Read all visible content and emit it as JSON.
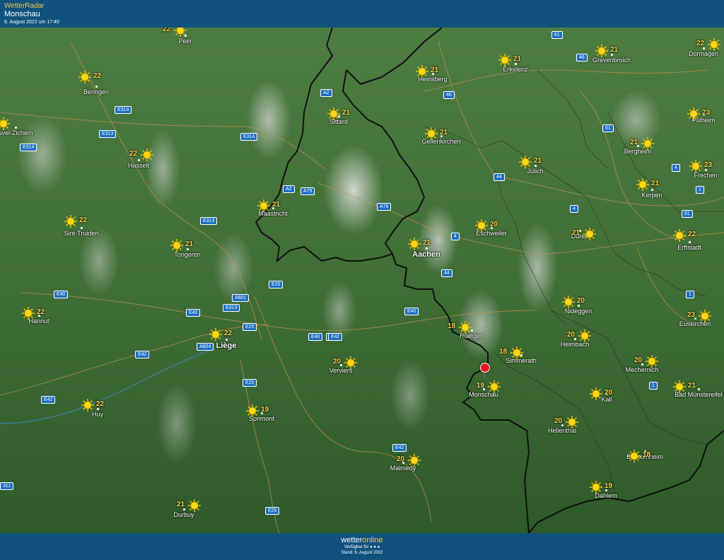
{
  "header": {
    "app_name": "WetterRadar",
    "location": "Monschau",
    "timestamp": "6. August 2022 um 17:40"
  },
  "footer": {
    "logo_prefix": "wetter",
    "logo_suffix": "online",
    "available_text": "Verfügbar für",
    "stand_text": "Stand: 6. August 2022"
  },
  "colors": {
    "header_bg": "#10527d",
    "accent": "#f3c64a",
    "pin": "#e01818"
  },
  "cities": [
    {
      "name": "Peer",
      "temp": "22",
      "icon": "sun-icon"
    },
    {
      "name": "Beringen",
      "temp": "22",
      "icon": "sun-icon"
    },
    {
      "name": "Hasselt",
      "temp": "22",
      "icon": "sun-icon"
    },
    {
      "name": "uvel-Zichem",
      "temp": "22",
      "icon": "sun-icon"
    },
    {
      "name": "Sint-Truiden",
      "temp": "22",
      "icon": "sun-icon"
    },
    {
      "name": "Tongeren",
      "temp": "21",
      "icon": "sun-icon"
    },
    {
      "name": "Hannut",
      "temp": "22",
      "icon": "sun-icon"
    },
    {
      "name": "Liège",
      "temp": "22",
      "icon": "sun-icon"
    },
    {
      "name": "Huy",
      "temp": "22",
      "icon": "sun-icon"
    },
    {
      "name": "Sprimont",
      "temp": "19",
      "icon": "sun-icon"
    },
    {
      "name": "Durbuy",
      "temp": "21",
      "icon": "sun-icon"
    },
    {
      "name": "Maastricht",
      "temp": "21",
      "icon": "sun-icon"
    },
    {
      "name": "Sittard",
      "temp": "21",
      "icon": "sun-icon"
    },
    {
      "name": "Heinsberg",
      "temp": "21",
      "icon": "sun-icon"
    },
    {
      "name": "Geilenkirchen",
      "temp": "21",
      "icon": "sun-icon"
    },
    {
      "name": "Erkelenz",
      "temp": "21",
      "icon": "sun-icon"
    },
    {
      "name": "Grevenbroich",
      "temp": "21",
      "icon": "sun-icon"
    },
    {
      "name": "Dormagen",
      "temp": "22",
      "icon": "sun-icon"
    },
    {
      "name": "Pulheim",
      "temp": "23",
      "icon": "sun-icon"
    },
    {
      "name": "Bergheim",
      "temp": "21",
      "icon": "sun-icon"
    },
    {
      "name": "Frechen",
      "temp": "23",
      "icon": "sun-icon"
    },
    {
      "name": "Kerpen",
      "temp": "21",
      "icon": "sun-icon"
    },
    {
      "name": "Erftstadt",
      "temp": "22",
      "icon": "sun-icon"
    },
    {
      "name": "Jülich",
      "temp": "21",
      "icon": "sun-icon"
    },
    {
      "name": "Eschweiler",
      "temp": "20",
      "icon": "sun-icon"
    },
    {
      "name": "Düren",
      "temp": "21",
      "icon": "sun-icon"
    },
    {
      "name": "Aachen",
      "temp": "21",
      "icon": "sun-icon"
    },
    {
      "name": "Nideggen",
      "temp": "20",
      "icon": "sun-icon"
    },
    {
      "name": "Euskirchen",
      "temp": "23",
      "icon": "sun-icon"
    },
    {
      "name": "Heimbach",
      "temp": "20",
      "icon": "sun-icon"
    },
    {
      "name": "Roetgen",
      "temp": "18",
      "icon": "sun-icon"
    },
    {
      "name": "Simmerath",
      "temp": "18",
      "icon": "sun-icon"
    },
    {
      "name": "Monschau",
      "temp": "19",
      "icon": "sun-icon"
    },
    {
      "name": "Mechernich",
      "temp": "20",
      "icon": "sun-icon"
    },
    {
      "name": "Kall",
      "temp": "20",
      "icon": "sun-icon"
    },
    {
      "name": "Bad Münstereifel",
      "temp": "21",
      "icon": "sun-icon"
    },
    {
      "name": "Hellenthal",
      "temp": "20",
      "icon": "sun-icon"
    },
    {
      "name": "Blankenheim",
      "temp": "18",
      "icon": "sun-icon"
    },
    {
      "name": "Dahlem",
      "temp": "19",
      "icon": "sun-icon"
    },
    {
      "name": "Verviers",
      "temp": "20",
      "icon": "sun-icon"
    },
    {
      "name": "Malmedy",
      "temp": "20",
      "icon": "sun-icon"
    }
  ],
  "roads": [
    "E314",
    "E313",
    "E314",
    "E314",
    "E313",
    "E40",
    "E40",
    "E313",
    "A601",
    "E25",
    "E40",
    "E25",
    "A604",
    "E42",
    "E40",
    "E42",
    "E42",
    "E25",
    "E42",
    "E25",
    "A2",
    "A2",
    "A79",
    "A76",
    "46",
    "61",
    "46",
    "61",
    "44",
    "4",
    "4",
    "1",
    "61",
    "4",
    "44",
    "1",
    "1",
    "E40",
    "311"
  ]
}
